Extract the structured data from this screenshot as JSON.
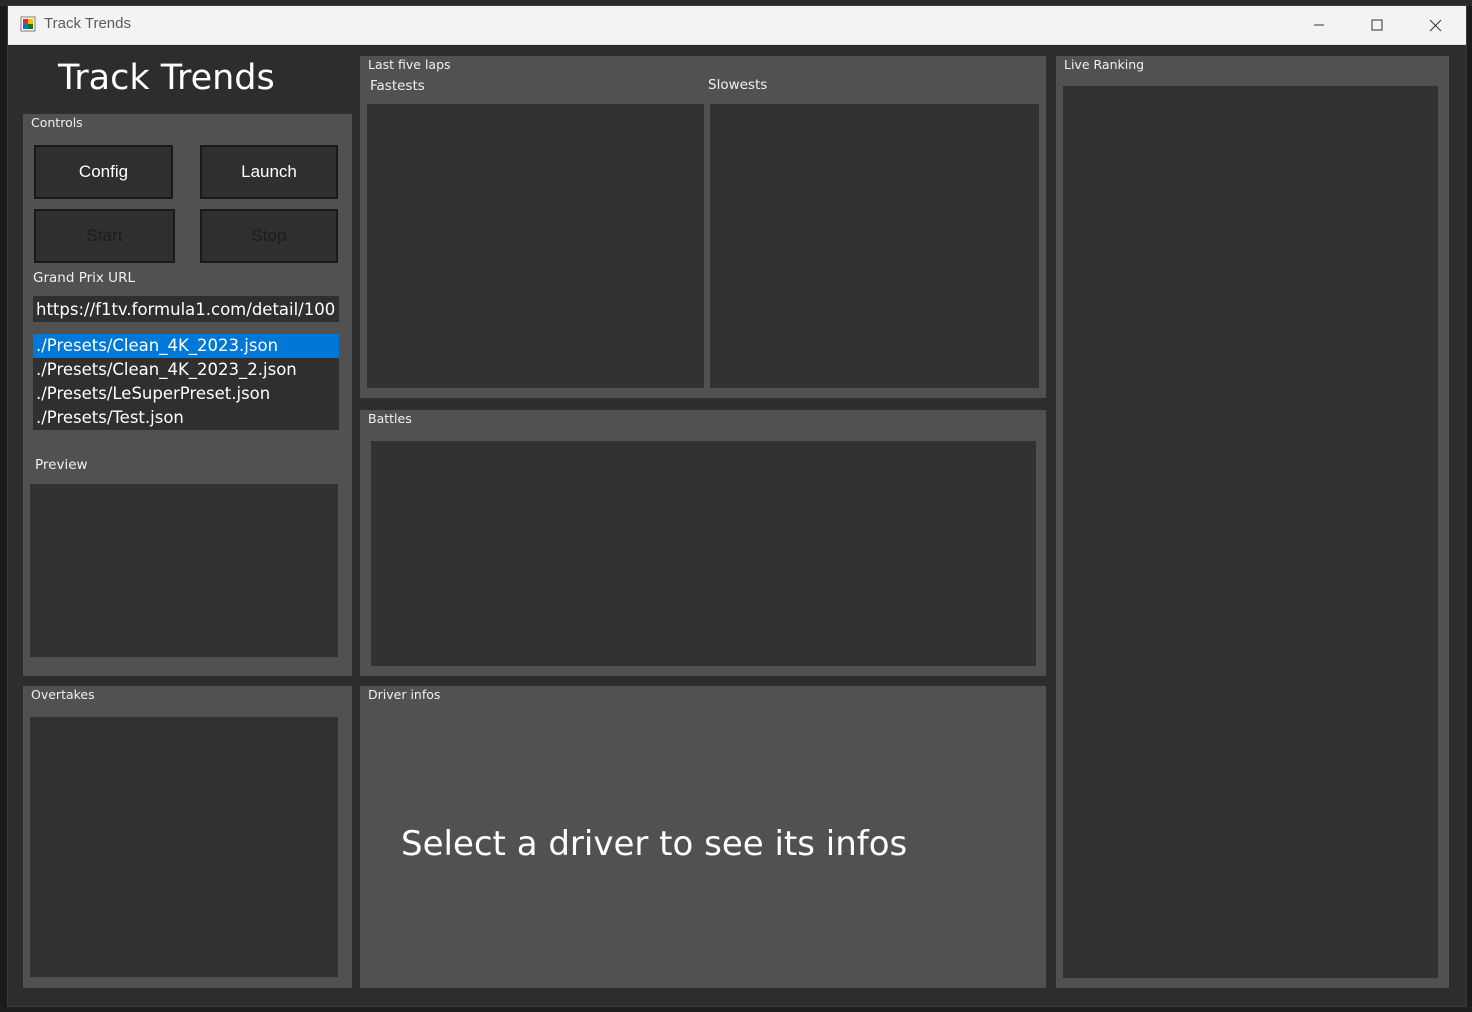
{
  "window": {
    "title": "Track Trends",
    "controls": [
      "minimize-icon",
      "maximize-icon",
      "close-icon"
    ]
  },
  "app": {
    "heading": "Track Trends"
  },
  "controls_panel": {
    "title": "Controls",
    "buttons": {
      "config": "Config",
      "launch": "Launch",
      "start": "Start",
      "stop": "Stop"
    },
    "url_label": "Grand Prix URL",
    "url_value": "https://f1tv.formula1.com/detail/100",
    "presets": [
      "./Presets/Clean_4K_2023.json",
      "./Presets/Clean_4K_2023_2.json",
      "./Presets/LeSuperPreset.json",
      "./Presets/Test.json"
    ],
    "selected_preset_index": 0,
    "preview_label": "Preview"
  },
  "last_five_laps": {
    "title": "Last five laps",
    "fastests_label": "Fastests",
    "slowests_label": "Slowests"
  },
  "battles": {
    "title": "Battles"
  },
  "live_ranking": {
    "title": "Live Ranking"
  },
  "overtakes": {
    "title": "Overtakes"
  },
  "driver_infos": {
    "title": "Driver infos",
    "placeholder": "Select a driver to see its infos"
  },
  "colors": {
    "selection": "#0078d7",
    "panel": "#515151",
    "well": "#323232",
    "window_bg": "#2d2d2d",
    "titlebar": "#f3f3f3"
  }
}
